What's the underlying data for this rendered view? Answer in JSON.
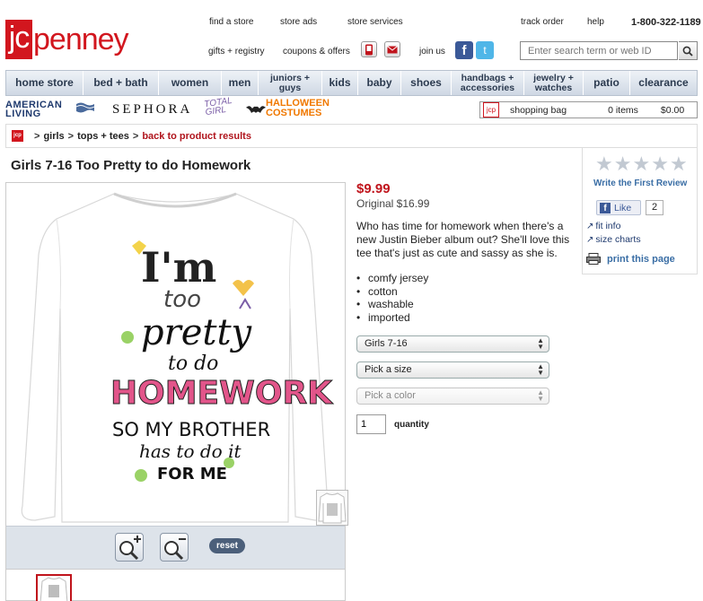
{
  "brand": {
    "logo_box": "jc",
    "logo_rest": "penney",
    "accent": "#d2161e"
  },
  "utility_links": {
    "find_store": "find a store",
    "store_ads": "store ads",
    "store_services": "store services",
    "track_order": "track order",
    "help": "help",
    "phone": "1-800-322-1189",
    "gifts": "gifts + registry",
    "coupons": "coupons & offers",
    "join_us": "join us"
  },
  "search": {
    "placeholder": "Enter search term or web ID",
    "icon": "magnifier-icon"
  },
  "nav": [
    {
      "label": "home store"
    },
    {
      "label": "bed + bath"
    },
    {
      "label": "women"
    },
    {
      "label": "men"
    },
    {
      "label": "juniors + guys"
    },
    {
      "label": "kids"
    },
    {
      "label": "baby"
    },
    {
      "label": "shoes"
    },
    {
      "label": "handbags + accessories"
    },
    {
      "label": "jewelry + watches"
    },
    {
      "label": "patio"
    },
    {
      "label": "clearance"
    }
  ],
  "brands": {
    "american_living_1": "AMERICAN",
    "american_living_2": "LIVING",
    "sephora": "SEPHORA",
    "total_girl_1": "TOTAL",
    "total_girl_2": "GIRL",
    "halloween_1": "HALLOWEEN",
    "halloween_2": "COSTUMES"
  },
  "bag": {
    "icon_text": "jcp",
    "label": "shopping bag",
    "items": "0 items",
    "total": "$0.00"
  },
  "breadcrumb": {
    "logo_text": "jcp",
    "sep": ">",
    "items": [
      "girls",
      "tops + tees"
    ],
    "back": "back to product results"
  },
  "product": {
    "title": "Girls 7-16 Too Pretty to do Homework",
    "price": "$9.99",
    "original": "Original $16.99",
    "description": "Who has time for homework when there's a new Justin Bieber album out? She'll love this tee that's just as cute and sassy as she is.",
    "features": [
      "comfy jersey",
      "cotton",
      "washable",
      "imported"
    ],
    "size_range": "Girls 7-16",
    "size_placeholder": "Pick a size",
    "color_placeholder": "Pick a color",
    "quantity": "1",
    "quantity_label": "quantity",
    "shirt_text": {
      "line1": "I'm",
      "line2": "too",
      "line3": "pretty",
      "line4": "to do",
      "line5": "HOMEWORK",
      "line6": "SO MY BROTHER",
      "line7": "has to do it",
      "line8": "FOR ME"
    }
  },
  "zoom": {
    "reset": "reset"
  },
  "reviews": {
    "rating": 0,
    "max_rating": 5,
    "write_first": "Write the First Review",
    "like_label": "Like",
    "like_count": "2",
    "fit_info": "fit info",
    "size_charts": "size charts",
    "print": "print this page"
  }
}
